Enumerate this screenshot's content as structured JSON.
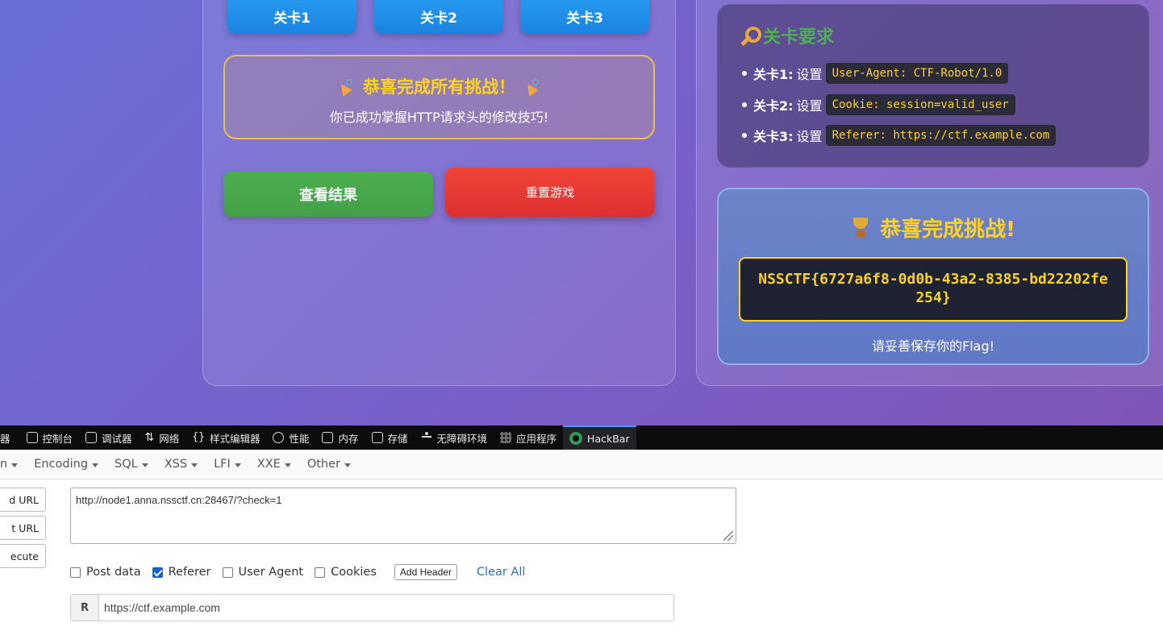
{
  "game": {
    "levels": [
      "关卡1",
      "关卡2",
      "关卡3"
    ],
    "congrats_title": "恭喜完成所有挑战！",
    "congrats_sub": "你已成功掌握HTTP请求头的修改技巧!",
    "result_button": "查看结果",
    "reset_button": "重置游戏"
  },
  "requirements": {
    "title": "关卡要求",
    "items": [
      {
        "label": "关卡1:",
        "verb": "设置",
        "code": "User-Agent: CTF-Robot/1.0"
      },
      {
        "label": "关卡2:",
        "verb": "设置",
        "code": "Cookie: session=valid_user"
      },
      {
        "label": "关卡3:",
        "verb": "设置",
        "code": "Referer: https://ctf.example.com"
      }
    ]
  },
  "flag_panel": {
    "title": "恭喜完成挑战!",
    "flag": "NSSCTF{6727a6f8-0d0b-43a2-8385-bd22202fe254}",
    "note": "请妥善保存你的Flag!"
  },
  "devtools": {
    "tabs": [
      "器",
      "控制台",
      "调试器",
      "网络",
      "样式编辑器",
      "性能",
      "内存",
      "存储",
      "无障碍环境",
      "应用程序",
      "HackBar"
    ],
    "active_tab": "HackBar"
  },
  "hackbar": {
    "menu": [
      "n",
      "Encoding",
      "SQL",
      "XSS",
      "LFI",
      "XXE",
      "Other"
    ],
    "side_buttons": [
      "d URL",
      "t URL",
      "ecute"
    ],
    "url": "http://node1.anna.nssctf.cn:28467/?check=1",
    "options": [
      {
        "label": "Post data",
        "checked": false
      },
      {
        "label": "Referer",
        "checked": true
      },
      {
        "label": "User Agent",
        "checked": false
      },
      {
        "label": "Cookies",
        "checked": false
      }
    ],
    "add_header": "Add Header",
    "clear_all": "Clear All",
    "header_key": "R",
    "header_value": "https://ctf.example.com"
  },
  "colors": {
    "accent_yellow": "#ffd21f",
    "success_green": "#4caf50",
    "danger_red": "#f04438",
    "level_blue": "#2a9df4"
  }
}
